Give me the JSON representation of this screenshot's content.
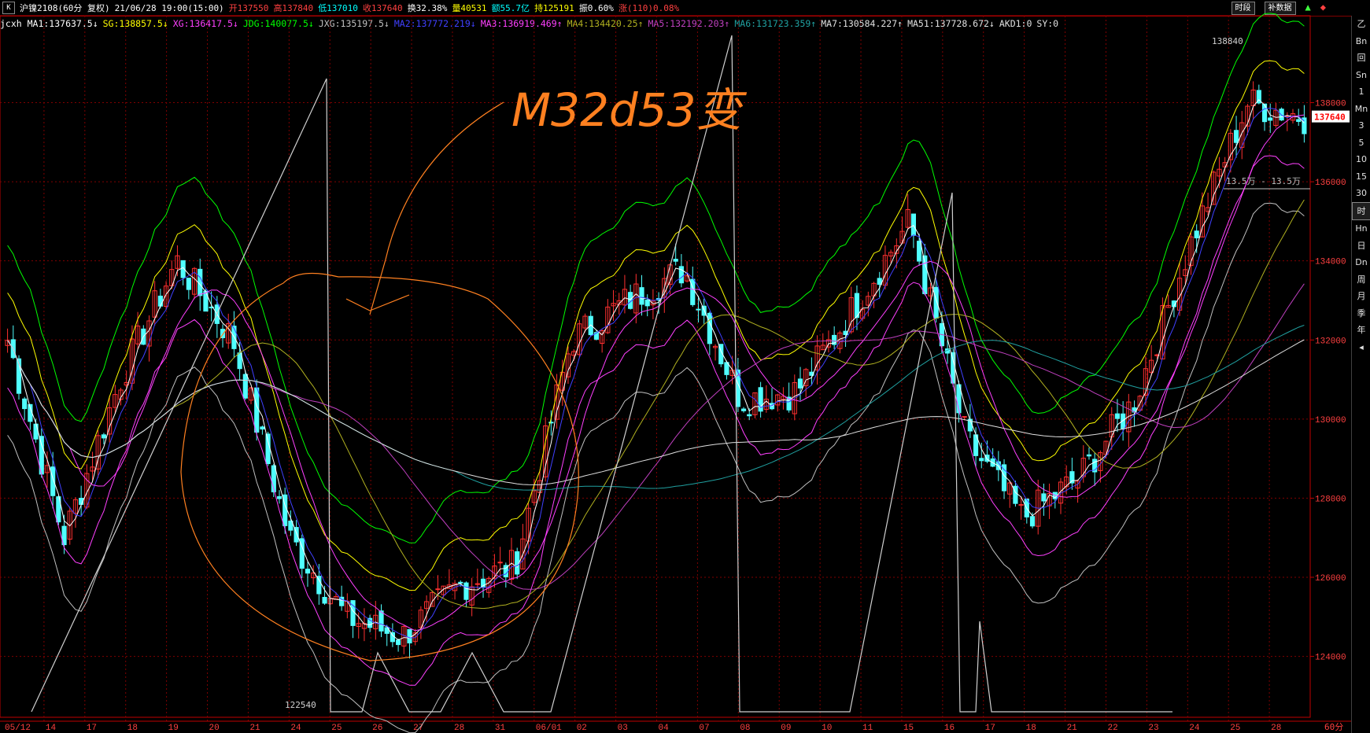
{
  "header": {
    "symbol": "沪镍2108(60分 复权)",
    "time": "21/06/28 19:00(15:00)",
    "open_label": "开137550",
    "high_label": "高137840",
    "low_label": "低137010",
    "close_label": "收137640",
    "turnover_label": "换32.38%",
    "volume_label": "量40531",
    "amount_label": "额55.7亿",
    "oi_label": "持125191",
    "amp_label": "振0.60%",
    "change_label": "涨(110)0.08%",
    "btn_period": "时段",
    "btn_restore": "补数据"
  },
  "indicators": [
    {
      "text": "jcxh MA1:137637.5",
      "arrow": "↓",
      "color": "#ffffff"
    },
    {
      "text": "SG:138857.5",
      "arrow": "↓",
      "color": "#ffff00"
    },
    {
      "text": "XG:136417.5",
      "arrow": "↓",
      "color": "#ff40ff"
    },
    {
      "text": "JDG:140077.5",
      "arrow": "↓",
      "color": "#00ff00"
    },
    {
      "text": "JXG:135197.5",
      "arrow": "↓",
      "color": "#c0c0c0"
    },
    {
      "text": "MA2:137772.219",
      "arrow": "↓",
      "color": "#4040ff"
    },
    {
      "text": "MA3:136919.469",
      "arrow": "↑",
      "color": "#ff40ff"
    },
    {
      "text": "MA4:134420.25",
      "arrow": "↑",
      "color": "#b0b020"
    },
    {
      "text": "MA5:132192.203",
      "arrow": "↑",
      "color": "#c040c0"
    },
    {
      "text": "MA6:131723.359",
      "arrow": "↑",
      "color": "#20a0a0"
    },
    {
      "text": "MA7:130584.227",
      "arrow": "↑",
      "color": "#e0e0e0"
    },
    {
      "text": "MA51:137728.672",
      "arrow": "↓",
      "color": "#e0e0e0"
    },
    {
      "text": "AKD1:0",
      "arrow": "",
      "color": "#e0e0e0"
    },
    {
      "text": "SY:0",
      "arrow": "",
      "color": "#e0e0e0"
    }
  ],
  "annotation_text": "M32d53变",
  "high_marker": "138840",
  "low_marker": "122540",
  "current_price": "137640",
  "cross_label": "13.5万 - 13.5万",
  "chart_data": {
    "type": "candlestick",
    "ylim": [
      122600,
      139800
    ],
    "y_ticks": [
      124000,
      126000,
      128000,
      130000,
      132000,
      134000,
      136000,
      138000
    ],
    "x_labels": [
      "05/12",
      "14",
      "17",
      "18",
      "19",
      "20",
      "21",
      "24",
      "25",
      "26",
      "27",
      "28",
      "31",
      "06/01",
      "02",
      "03",
      "04",
      "07",
      "08",
      "09",
      "10",
      "11",
      "15",
      "16",
      "17",
      "18",
      "21",
      "22",
      "23",
      "24",
      "25",
      "28"
    ],
    "period_label": "60分",
    "key_closes": [
      132000,
      127000,
      131000,
      134000,
      132000,
      127000,
      125000,
      124500,
      125800,
      126300,
      132000,
      133000,
      133800,
      130500,
      130700,
      132800,
      135000,
      129500,
      127500,
      128500,
      130500,
      134500,
      138000,
      137640
    ],
    "colors": {
      "up": "#ff3030",
      "down": "#50ffff",
      "grid": "#800000",
      "axis": "#c00000"
    }
  },
  "sidebar": [
    "乙",
    "Bn",
    "回",
    "Sn",
    "1",
    "Mn",
    "3",
    "5",
    "10",
    "15",
    "30",
    "时",
    "Hn",
    "日",
    "Dn",
    "周",
    "月",
    "季",
    "年",
    "◂"
  ]
}
